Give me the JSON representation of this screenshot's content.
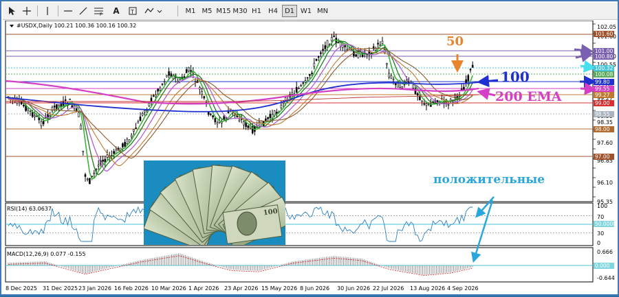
{
  "toolbar": {
    "tools": [
      "cursor-icon",
      "crosshair-icon",
      "vertical-line-icon",
      "horizontal-line-icon",
      "trendline-icon",
      "fibo-icon",
      "text-icon",
      "label-icon",
      "shapes-icon"
    ],
    "timeframes": [
      "M1",
      "M5",
      "M15",
      "M30",
      "H1",
      "H4",
      "D1",
      "W1",
      "MN"
    ],
    "active_timeframe": "D1"
  },
  "main_pane": {
    "header": "#USDX,Daily  100.21 100.36 100.16 100.32",
    "price_axis": [
      "102.05",
      "101.60",
      "100.80",
      "100.55",
      "99.80",
      "99.27",
      "98.55",
      "98.35",
      "97.60",
      "96.85",
      "96.10",
      "95.35"
    ],
    "tags": [
      {
        "text": "101.60",
        "color": "#a0522d"
      },
      {
        "text": "101.00",
        "color": "#7b5fb0"
      },
      {
        "text": "100.80",
        "color": "#7b5fb0"
      },
      {
        "text": "100.32",
        "color": "#46c6d8"
      },
      {
        "text": "100.08",
        "color": "#5aa85a"
      },
      {
        "text": "99.80",
        "color": "#1f2fd0"
      },
      {
        "text": "99.55",
        "color": "#d33fc5"
      },
      {
        "text": "99.27",
        "color": "#c07a30"
      },
      {
        "text": "99.00",
        "color": "#d83030"
      },
      {
        "text": "98.55",
        "color": "#aab4be"
      },
      {
        "text": "98.00",
        "color": "#b06a30"
      },
      {
        "text": "97.00",
        "color": "#a0522d"
      }
    ]
  },
  "rsi_pane": {
    "header": "RSI(14) 63.0637",
    "axis": [
      "100",
      "70",
      "50",
      "30",
      "0"
    ],
    "level_tag": "50.0000"
  },
  "macd_pane": {
    "header": "MACD(12,26,9) 0.077 -0.155",
    "axis": [
      "0.666",
      "0.000",
      "-0.644"
    ],
    "zero_tag": "0.000"
  },
  "date_axis": [
    "8 Dec 2025",
    "31 Dec 2025",
    "23 Jan 2026",
    "16 Feb 2026",
    "10 Mar 2026",
    "1 Apr 2026",
    "23 Apr 2026",
    "15 May 2026",
    "8 Jun 2026",
    "30 Jun 2026",
    "22 Jul 2026",
    "13 Aug 2026",
    "4 Sep 2026"
  ],
  "annotations": {
    "ma50": "50",
    "ma100": "100",
    "ema200": "200 EMA",
    "positive": "положительные"
  },
  "colors": {
    "ma50": "#e8842b",
    "ma100": "#1f2fd0",
    "ema200": "#d33fc5",
    "positive": "#2aa6dc",
    "bull_candle": "#000000",
    "bear_candle": "#000000"
  }
}
